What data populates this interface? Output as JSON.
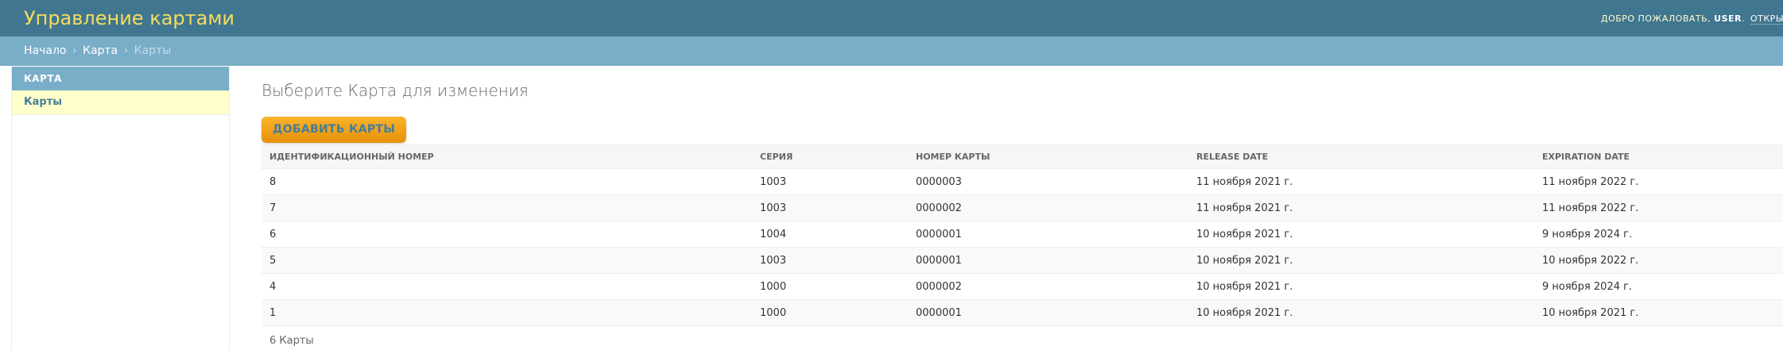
{
  "header": {
    "title": "Управление картами",
    "welcome": "Добро пожаловать,",
    "user": "user",
    "link_text": "Открыть са"
  },
  "breadcrumbs": {
    "home": "Начало",
    "sep1": "›",
    "app": "Карта",
    "sep2": "›",
    "current": "Карты"
  },
  "sidebar": {
    "caption": "Карта",
    "model": "Карты"
  },
  "main": {
    "title": "Выберите Карта для изменения",
    "add_button": "Добавить Карты",
    "columns": [
      "Идентификационный номер",
      "Серия",
      "Номер карты",
      "Release date",
      "Expiration date"
    ],
    "rows": [
      [
        "8",
        "1003",
        "0000003",
        "11 ноября 2021 г.",
        "11 ноября 2022 г."
      ],
      [
        "7",
        "1003",
        "0000002",
        "11 ноября 2021 г.",
        "11 ноября 2022 г."
      ],
      [
        "6",
        "1004",
        "0000001",
        "10 ноября 2021 г.",
        "9 ноября 2024 г."
      ],
      [
        "5",
        "1003",
        "0000001",
        "10 ноября 2021 г.",
        "10 ноября 2022 г."
      ],
      [
        "4",
        "1000",
        "0000002",
        "10 ноября 2021 г.",
        "9 ноября 2024 г."
      ],
      [
        "1",
        "1000",
        "0000001",
        "10 ноября 2021 г.",
        "10 ноября 2021 г."
      ]
    ],
    "paginator": "6 Карты"
  },
  "colors": {
    "header_bg": "#417690",
    "breadcrumb_bg": "#79aec8",
    "title_color": "#f5dd5d",
    "button_bg": "#f0a01a",
    "selected_row_bg": "#ffffcc"
  }
}
